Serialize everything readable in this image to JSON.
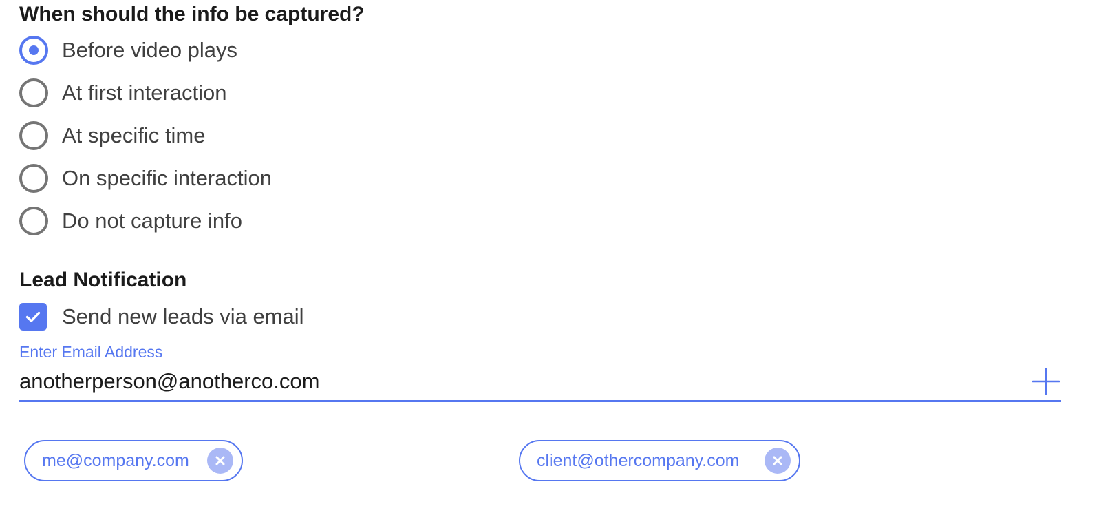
{
  "capture": {
    "title": "When should the info be captured?",
    "options": [
      {
        "label": "Before video plays",
        "checked": true
      },
      {
        "label": "At first interaction",
        "checked": false
      },
      {
        "label": "At specific time",
        "checked": false
      },
      {
        "label": "On specific interaction",
        "checked": false
      },
      {
        "label": "Do not capture info",
        "checked": false
      }
    ]
  },
  "lead": {
    "title": "Lead Notification",
    "send_email_label": "Send new leads via email",
    "send_email_checked": true,
    "email_field_label": "Enter Email Address",
    "email_value": "anotherperson@anotherco.com",
    "add_icon": "plus-icon",
    "chips": [
      {
        "email": "me@company.com",
        "remove_icon": "close-icon"
      },
      {
        "email": "client@othercompany.com",
        "remove_icon": "close-icon"
      }
    ]
  },
  "colors": {
    "accent": "#5677f0",
    "chip_remove_bg": "#aab8f6",
    "radio_border": "#757575",
    "heading": "#1b1b1b"
  }
}
